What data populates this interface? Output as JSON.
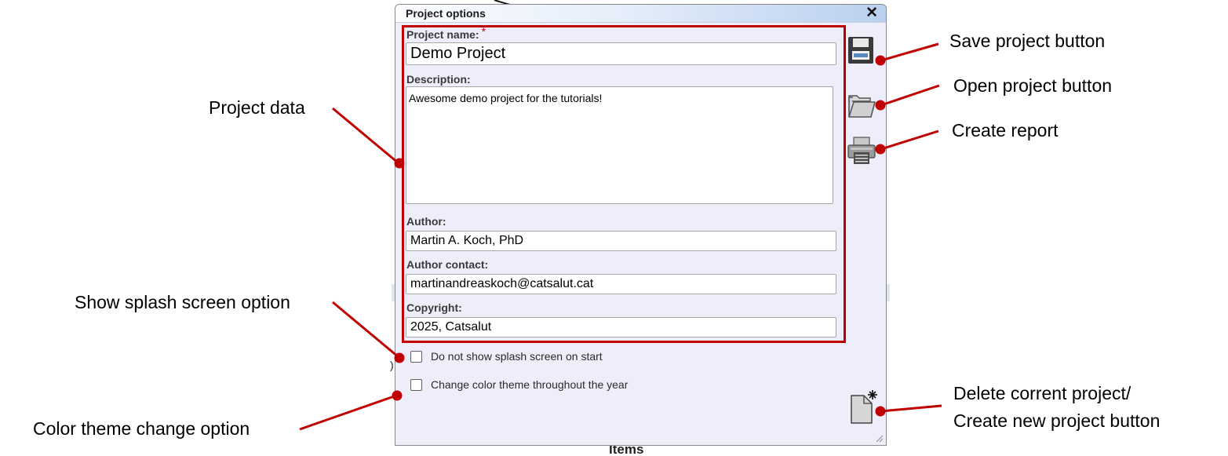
{
  "dialog": {
    "title": "Project options",
    "close_glyph": "✕",
    "project_name_label": "Project name:",
    "required_marker": "*",
    "project_name_value": "Demo Project",
    "description_label": "Description:",
    "description_value": "Awesome demo project for the tutorials!",
    "author_label": "Author:",
    "author_value": "Martin A. Koch, PhD",
    "author_contact_label": "Author contact:",
    "author_contact_value": "martinandreaskoch@catsalut.cat",
    "copyright_label": "Copyright:",
    "copyright_value": "2025, Catsalut",
    "splash_checkbox_label": "Do not show splash screen on start",
    "splash_checked": false,
    "theme_checkbox_label": "Change color theme throughout the year",
    "theme_checked": false,
    "icons": {
      "save": "save-icon",
      "open": "folder-open-icon",
      "report": "printer-icon",
      "new": "new-document-icon"
    }
  },
  "annotations": {
    "save": "Save project button",
    "open": "Open project button",
    "report": "Create report",
    "project_data": "Project data",
    "splash": "Show splash screen option",
    "theme": "Color theme change option",
    "delete_line1": "Delete corrent project/",
    "delete_line2": "Create new project button"
  },
  "background": {
    "partial_text": "Items",
    "partial_glyph": ")"
  },
  "colors": {
    "annotation_red": "#c00000",
    "dialog_bg": "#eeeefa",
    "title_gradient_end": "#b9d0ee"
  }
}
